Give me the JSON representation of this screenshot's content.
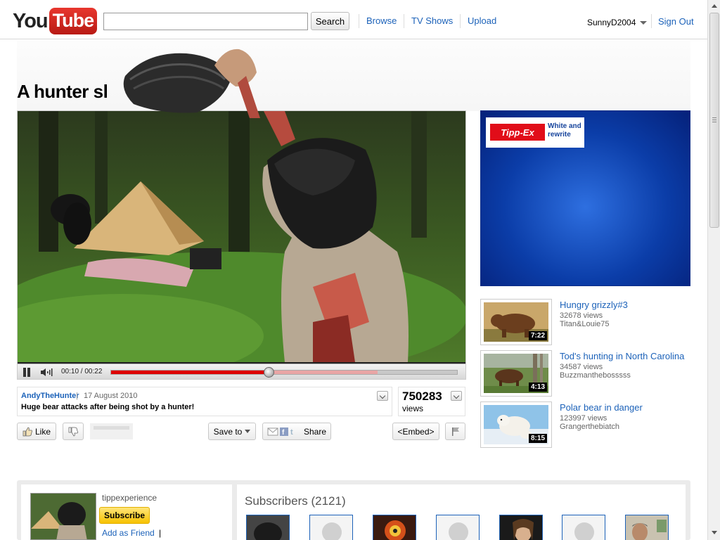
{
  "header": {
    "logo": {
      "you": "You",
      "tube": "Tube"
    },
    "search": {
      "value": "",
      "button_label": "Search"
    },
    "nav": [
      "Browse",
      "TV Shows",
      "Upload"
    ],
    "username": "SunnyD2004",
    "signout_label": "Sign Out"
  },
  "video": {
    "title_visible": "A hunter  sl",
    "time_display": "00:10 / 00:22",
    "progress_fraction": 0.455,
    "buffered_fraction": 0.77
  },
  "info": {
    "uploader": "AndyTheHunter",
    "separator": "|",
    "date": "17 August 2010",
    "description": "Huge bear attacks after being shot by a hunter!",
    "view_count": "750283",
    "view_label": "views"
  },
  "actions": {
    "like_label": "Like",
    "save_label": "Save to",
    "share_label": "Share",
    "embed_label": "<Embed>"
  },
  "ad": {
    "brand": "Tipp-Ex",
    "tagline_1": "White and",
    "tagline_2": "rewrite"
  },
  "related": [
    {
      "title": "Hungry grizzly#3",
      "views": "32678 views",
      "author": "Titan&Louie75",
      "duration": "7:22"
    },
    {
      "title": "Tod's hunting in North Carolina",
      "views": "34587 views",
      "author": "Buzzmanthebosssss",
      "duration": "4:13"
    },
    {
      "title": "Polar bear in danger",
      "views": "123997 views",
      "author": "Grangerthebiatch",
      "duration": "8:15"
    }
  ],
  "channel": {
    "name": "tippexperience",
    "subscribe_label": "Subscribe",
    "add_friend_label": "Add as Friend",
    "add_friend_sep": "|"
  },
  "subscribers": {
    "title": "Subscribers (2121)"
  },
  "colors": {
    "link": "#1c62b9",
    "progress": "#dd0000",
    "subscribe": "#f7c200",
    "ad_blue": "#0b3da8"
  }
}
